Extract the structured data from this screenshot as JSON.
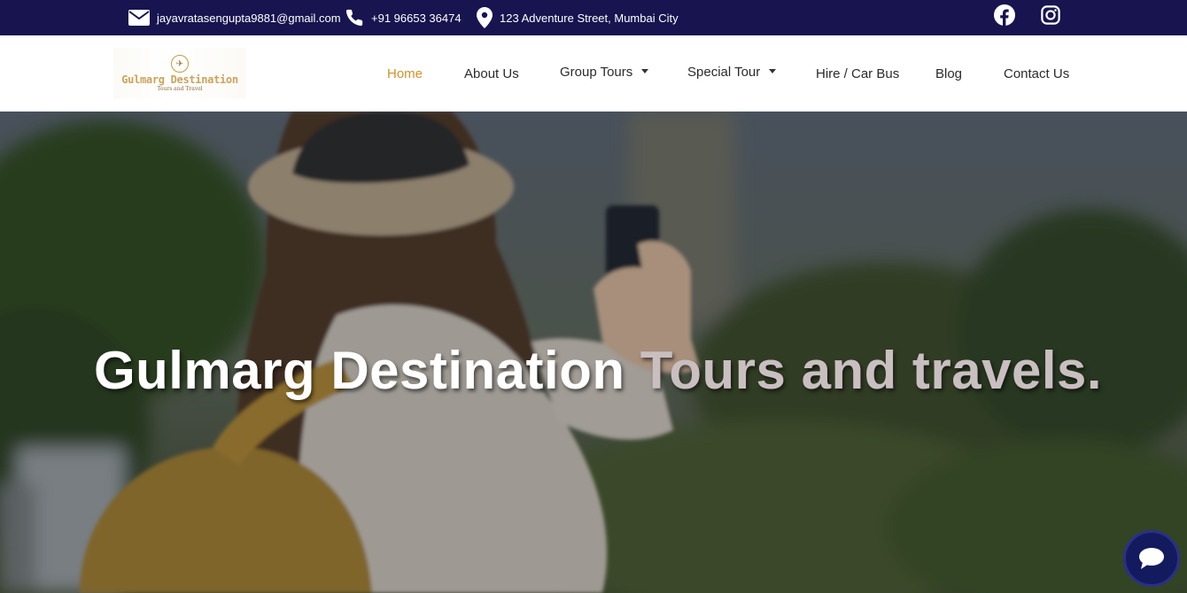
{
  "topbar": {
    "email": "jayavratasengupta9881@gmail.com",
    "phone": "+91 96653 36474",
    "address": "123 Adventure Street, Mumbai City",
    "email_icon": "envelope-icon",
    "phone_icon": "phone-icon",
    "address_icon": "map-marker-icon",
    "social": [
      "facebook-icon",
      "instagram-icon"
    ]
  },
  "header": {
    "logo_title": "Gulmarg Destination",
    "logo_subtitle": "Tours and Travel"
  },
  "nav": {
    "items": [
      {
        "label": "Home",
        "active": true
      },
      {
        "label": "About Us"
      },
      {
        "label": "Group Tours",
        "dropdown": true
      },
      {
        "label": "Special Tour",
        "dropdown": true
      },
      {
        "label": "Hire / Car Bus"
      },
      {
        "label": "Blog"
      },
      {
        "label": "Contact Us"
      }
    ]
  },
  "hero": {
    "title_main": "Gulmarg Destination",
    "title_accent": "Tours and travels."
  },
  "colors": {
    "topbar": "#17144f",
    "accent": "#d3922e",
    "chat_button": "#141a5e"
  }
}
